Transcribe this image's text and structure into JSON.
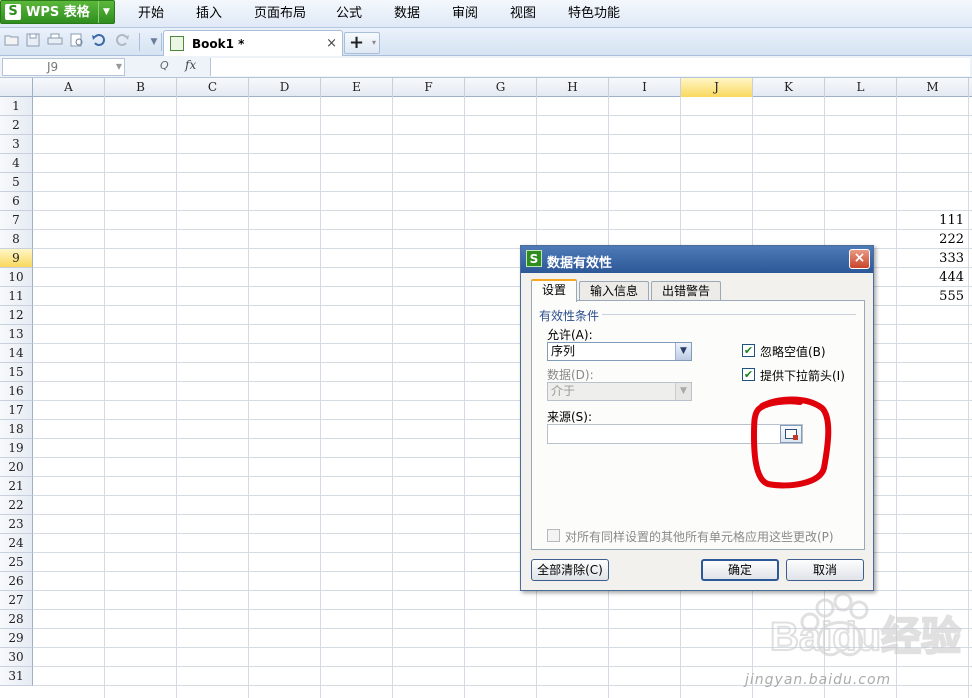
{
  "app": {
    "name": "WPS 表格",
    "logo": "S"
  },
  "menu": [
    "开始",
    "插入",
    "页面布局",
    "公式",
    "数据",
    "审阅",
    "视图",
    "特色功能"
  ],
  "toolbar": {
    "icons": [
      "open-icon",
      "save-icon",
      "print-icon",
      "print-preview-icon",
      "undo-icon",
      "redo-icon",
      "customize-dropdown-icon"
    ]
  },
  "document_tab": {
    "name": "Book1 *",
    "close": "×"
  },
  "new_tab": {
    "plus": "+",
    "dropdown": "▾"
  },
  "formula_bar": {
    "cell_ref": "J9",
    "fx": "fx",
    "zoom_icon": "Q",
    "content": ""
  },
  "sheet": {
    "columns": [
      "A",
      "B",
      "C",
      "D",
      "E",
      "F",
      "G",
      "H",
      "I",
      "J",
      "K",
      "L",
      "M"
    ],
    "selected_column": "J",
    "rows": [
      "1",
      "2",
      "3",
      "4",
      "5",
      "6",
      "7",
      "8",
      "9",
      "10",
      "11",
      "12",
      "13",
      "14",
      "15",
      "16",
      "17",
      "18",
      "19",
      "20",
      "21",
      "22",
      "23",
      "24",
      "25",
      "26",
      "27",
      "28",
      "29",
      "30",
      "31"
    ],
    "selected_row": "9",
    "values": [
      {
        "col": "M",
        "row": 7,
        "value": "111"
      },
      {
        "col": "M",
        "row": 8,
        "value": "222"
      },
      {
        "col": "M",
        "row": 9,
        "value": "333"
      },
      {
        "col": "M",
        "row": 10,
        "value": "444"
      },
      {
        "col": "M",
        "row": 11,
        "value": "555"
      }
    ]
  },
  "dialog": {
    "title": "数据有效性",
    "close": "×",
    "tabs": [
      {
        "label": "设置",
        "active": true
      },
      {
        "label": "输入信息",
        "active": false
      },
      {
        "label": "出错警告",
        "active": false
      }
    ],
    "group_label": "有效性条件",
    "allow_label": "允许(A):",
    "allow_value": "序列",
    "data_label": "数据(D):",
    "data_value": "介于",
    "ignore_blank_label": "忽略空值(B)",
    "ignore_blank_checked": true,
    "dropdown_label": "提供下拉箭头(I)",
    "dropdown_checked": true,
    "source_label": "来源(S):",
    "source_value": "",
    "apply_all_label": "对所有同样设置的其他所有单元格应用这些更改(P)",
    "apply_all_checked": false,
    "clear_all": "全部清除(C)",
    "ok": "确定",
    "cancel": "取消"
  },
  "annotation_color": "#e0000a",
  "watermark": "jingyan.baidu.com",
  "watermark_brand": "Baidu经验",
  "colors": {
    "app_green": "#2f8d1f",
    "dialog_title": "#2c5897",
    "selection_yellow": "#f9d85e"
  }
}
